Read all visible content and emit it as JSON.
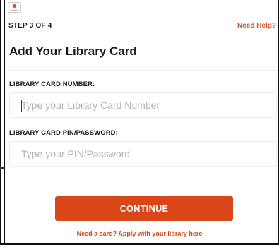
{
  "header": {
    "step_label": "STEP 3 OF 4",
    "help_link": "Need Help?"
  },
  "page": {
    "title": "Add Your Library Card"
  },
  "card_number": {
    "label": "LIBRARY CARD NUMBER:",
    "value": "",
    "placeholder": "Type your Library Card Number"
  },
  "pin": {
    "label": "LIBRARY CARD PIN/PASSWORD:",
    "value": "",
    "placeholder": "Type your PIN/Password"
  },
  "actions": {
    "continue_label": "CONTINUE",
    "apply_link": "Need a card? Apply with your library here"
  },
  "colors": {
    "accent": "#d94618",
    "text": "#1d1d1d",
    "placeholder": "#b4b4b4"
  },
  "icons": {
    "app_logo": "app-logo-icon"
  }
}
